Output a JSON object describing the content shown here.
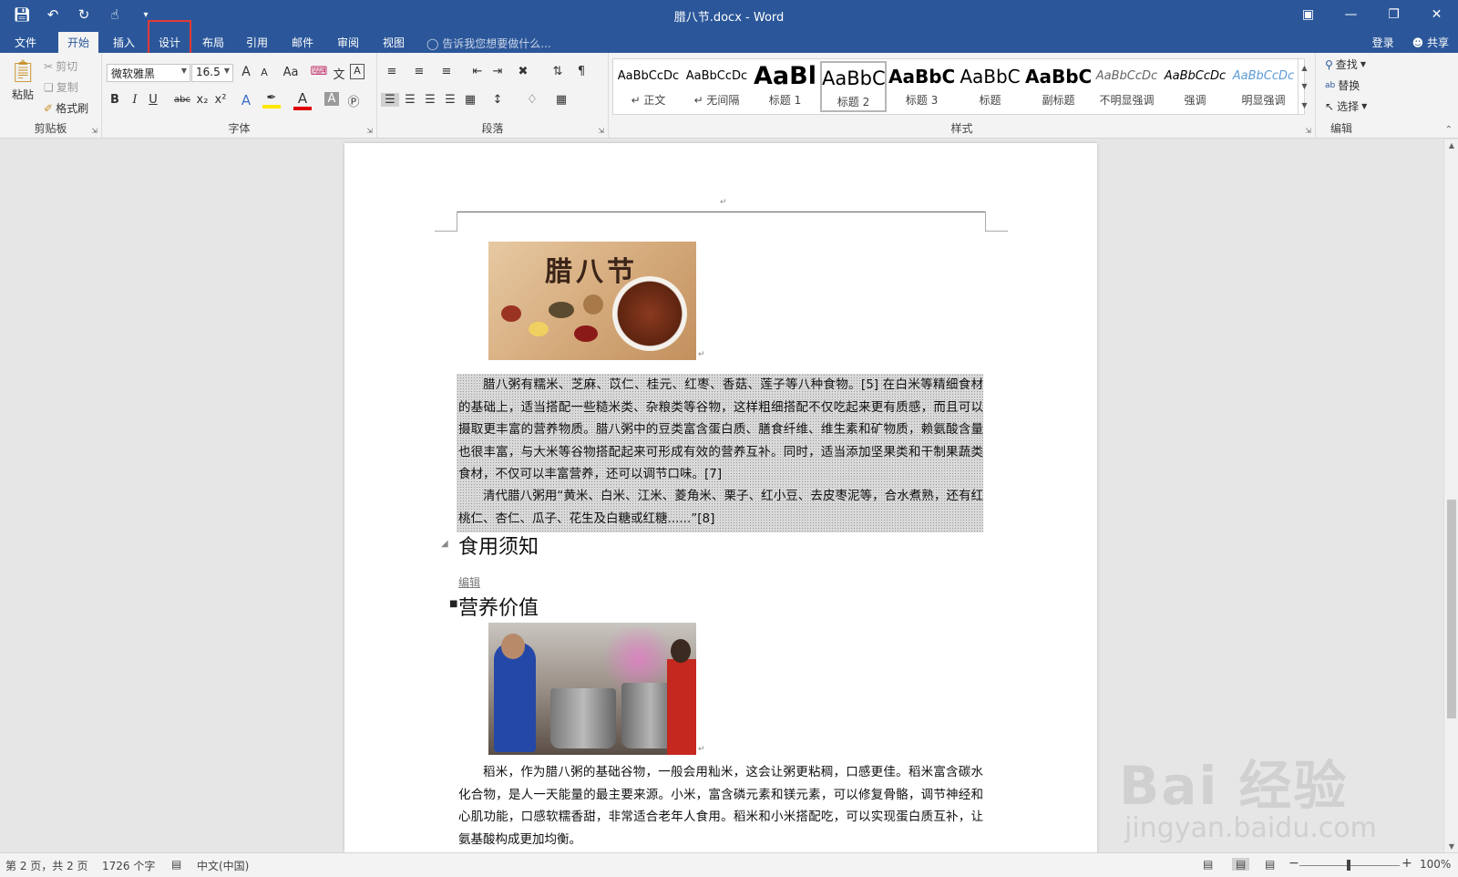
{
  "window": {
    "title": "腊八节.docx - Word"
  },
  "tabs": [
    {
      "label": "文件"
    },
    {
      "label": "开始"
    },
    {
      "label": "插入"
    },
    {
      "label": "设计"
    },
    {
      "label": "布局"
    },
    {
      "label": "引用"
    },
    {
      "label": "邮件"
    },
    {
      "label": "审阅"
    },
    {
      "label": "视图"
    }
  ],
  "tell_me": "告诉我您想要做什么...",
  "account": {
    "login": "登录",
    "share": "共享"
  },
  "clipboard": {
    "paste": "粘贴",
    "cut": "剪切",
    "copy": "复制",
    "format_painter": "格式刷",
    "label": "剪贴板"
  },
  "font": {
    "name": "微软雅黑",
    "size": "16.5",
    "label": "字体",
    "case_btn": "Aa",
    "bold": "B",
    "italic": "I",
    "underline": "U",
    "strike": "abc",
    "subscript": "x₂",
    "superscript": "x²",
    "grow": "A",
    "shrink": "A"
  },
  "paragraph": {
    "label": "段落"
  },
  "styles": {
    "label": "样式",
    "items": [
      {
        "sample": "AaBbCcDc",
        "name": "↵ 正文"
      },
      {
        "sample": "AaBbCcDc",
        "name": "↵ 无间隔"
      },
      {
        "sample": "AaBl",
        "name": "标题 1"
      },
      {
        "sample": "AaBbC",
        "name": "标题 2"
      },
      {
        "sample": "AaBbC",
        "name": "标题 3"
      },
      {
        "sample": "AaBbC",
        "name": "标题"
      },
      {
        "sample": "AaBbC",
        "name": "副标题"
      },
      {
        "sample": "AaBbCcDc",
        "name": "不明显强调"
      },
      {
        "sample": "AaBbCcDc",
        "name": "强调"
      },
      {
        "sample": "AaBbCcDc",
        "name": "明显强调"
      }
    ]
  },
  "editing": {
    "label": "编辑",
    "find": "查找",
    "replace": "替换",
    "select": "选择"
  },
  "document": {
    "image1_text": "腊八节",
    "para1": "腊八粥有糯米、芝麻、苡仁、桂元、红枣、香菇、莲子等八种食物。[5] 在白米等精细食材的基础上，适当搭配一些糙米类、杂粮类等谷物，这样粗细搭配不仅吃起来更有质感，而且可以摄取更丰富的营养物质。腊八粥中的豆类富含蛋白质、膳食纤维、维生素和矿物质，赖氨酸含量也很丰富，与大米等谷物搭配起来可形成有效的营养互补。同时，适当添加坚果类和干制果蔬类食材，不仅可以丰富营养，还可以调节口味。[7]",
    "para2": "清代腊八粥用“黄米、白米、江米、菱角米、栗子、红小豆、去皮枣泥等，合水煮熟，还有红桃仁、杏仁、瓜子、花生及白糖或红糖......”[8]",
    "heading1": "食用须知",
    "edit_link": "编辑",
    "heading2": "营养价值",
    "para3": "稻米，作为腊八粥的基础谷物，一般会用籼米，这会让粥更粘稠，口感更佳。稻米富含碳水化合物，是人一天能量的最主要来源。小米，富含磷元素和镁元素，可以修复骨骼，调节神经和心肌功能，口感软糯香甜，非常适合老年人食用。稻米和小米搭配吃，可以实现蛋白质互补，让氨基酸构成更加均衡。"
  },
  "statusbar": {
    "page": "第 2 页，共 2 页",
    "words": "1726 个字",
    "language": "中文(中国)",
    "zoom": "100%",
    "zoom_minus": "−",
    "zoom_plus": "+"
  },
  "watermark": {
    "logo": "Bai 经验",
    "url": "jingyan.baidu.com"
  },
  "colors": {
    "accent": "#2b579a",
    "highlight_box": "#e53935"
  }
}
